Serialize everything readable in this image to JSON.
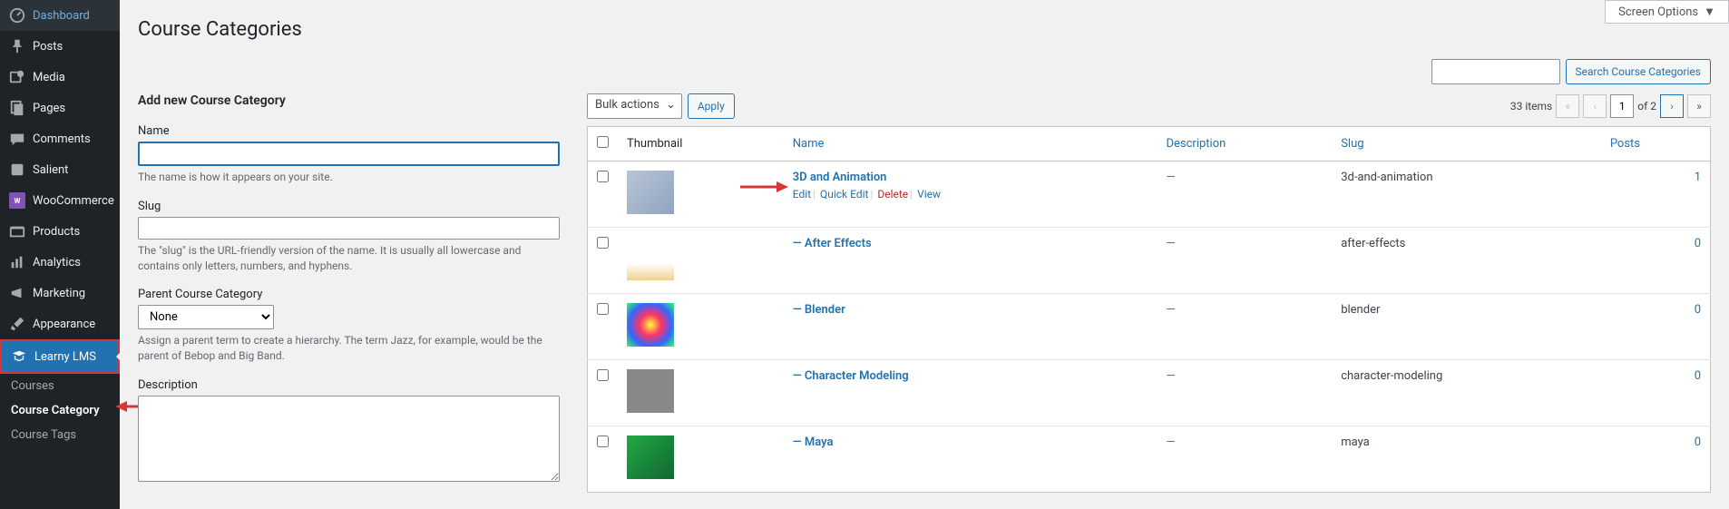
{
  "sidebar": {
    "items": [
      {
        "icon": "dashboard",
        "label": "Dashboard"
      },
      {
        "icon": "pin",
        "label": "Posts"
      },
      {
        "icon": "media",
        "label": "Media"
      },
      {
        "icon": "page",
        "label": "Pages"
      },
      {
        "icon": "comments",
        "label": "Comments"
      },
      {
        "icon": "salient",
        "label": "Salient"
      },
      {
        "icon": "woo",
        "label": "WooCommerce"
      },
      {
        "icon": "products",
        "label": "Products"
      },
      {
        "icon": "analytics",
        "label": "Analytics"
      },
      {
        "icon": "marketing",
        "label": "Marketing"
      },
      {
        "icon": "brush",
        "label": "Appearance"
      },
      {
        "icon": "learny",
        "label": "Learny LMS"
      }
    ],
    "submenu": [
      {
        "label": "Courses",
        "active": false
      },
      {
        "label": "Course Category",
        "active": true
      },
      {
        "label": "Course Tags",
        "active": false
      }
    ]
  },
  "header": {
    "screen_options": "Screen Options",
    "page_title": "Course Categories"
  },
  "form": {
    "heading": "Add new Course Category",
    "name_label": "Name",
    "name_help": "The name is how it appears on your site.",
    "slug_label": "Slug",
    "slug_help": "The \"slug\" is the URL-friendly version of the name. It is usually all lowercase and contains only letters, numbers, and hyphens.",
    "parent_label": "Parent Course Category",
    "parent_selected": "None",
    "parent_help": "Assign a parent term to create a hierarchy. The term Jazz, for example, would be the parent of Bebop and Big Band.",
    "desc_label": "Description"
  },
  "search": {
    "button": "Search Course Categories"
  },
  "bulk": {
    "label": "Bulk actions",
    "apply": "Apply"
  },
  "pagination": {
    "count": "33 items",
    "current": "1",
    "of": "of 2"
  },
  "table": {
    "columns": {
      "thumbnail": "Thumbnail",
      "name": "Name",
      "description": "Description",
      "slug": "Slug",
      "posts": "Posts"
    },
    "row_actions": {
      "edit": "Edit",
      "quick": "Quick Edit",
      "delete": "Delete",
      "view": "View"
    },
    "rows": [
      {
        "name": "3D and Animation",
        "desc": "—",
        "slug": "3d-and-animation",
        "posts": "1",
        "actions": true,
        "thumb": "t1"
      },
      {
        "name": "— After Effects",
        "desc": "—",
        "slug": "after-effects",
        "posts": "0",
        "thumb": "t2"
      },
      {
        "name": "— Blender",
        "desc": "—",
        "slug": "blender",
        "posts": "0",
        "thumb": "t3"
      },
      {
        "name": "— Character Modeling",
        "desc": "—",
        "slug": "character-modeling",
        "posts": "0",
        "thumb": "t4"
      },
      {
        "name": "— Maya",
        "desc": "—",
        "slug": "maya",
        "posts": "0",
        "thumb": "t5"
      }
    ]
  }
}
